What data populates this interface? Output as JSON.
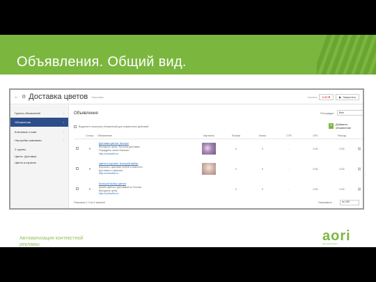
{
  "slide": {
    "title": "Объявления. Общий вид.",
    "footer_text": "Автоматизация контекстной рекламы",
    "logo_text": "aori",
    "logo_sub": "ads optimization",
    "colors": {
      "accent": "#7bb73f",
      "nav_active": "#2d4e8a",
      "link": "#2d6eb5",
      "balance": "#cc0000"
    }
  },
  "app": {
    "title": "Доставка цветов",
    "subtitle": "Черновик",
    "balance_label": "Баланс",
    "balance_value": "0.00 ₽",
    "launch_label": "Запустить",
    "icons": [
      "back-arrow-icon",
      "gear-icon",
      "play-icon"
    ]
  },
  "sidebar": {
    "items": [
      {
        "label": "Группы объявлений",
        "active": false
      },
      {
        "label": "Объявления",
        "active": true
      },
      {
        "label": "Ключевые слова",
        "active": false
      },
      {
        "label": "Настройки кампании",
        "active": false
      }
    ],
    "group_header": "2 группы",
    "groups": [
      "Цветы. Доставка",
      "Цветы в корзине"
    ]
  },
  "main": {
    "title": "Объявления",
    "period_label": "Площадки",
    "period_value": "Все",
    "toolbar_text": "Выделите несколько объявлений для совместных действий",
    "add_label": "Добавить объявление",
    "columns": [
      "Статус",
      "Объявление",
      "Картинка",
      "Показы",
      "Клики",
      "CTR",
      "CPC",
      "Расход"
    ],
    "rows": [
      {
        "title": "Доставка цветов. Быстро!",
        "line1": "Выгодные цены, быстрая доставка.",
        "line2": "Порадуйте своих близких!",
        "url": "http://cvetochki.ru",
        "shows": "0",
        "clicks": "0",
        "ctr": "-",
        "cpc": "0.00",
        "spend": "0.00",
        "thumb": "#b59bb8"
      },
      {
        "title": "Цветы в корзине. Большой выбор",
        "line1": "Корзины с цветами любой сложности.",
        "line2": "Доставка и гарантия.",
        "url": "http://cvetochki.ru",
        "shows": "0",
        "clicks": "0",
        "ctr": "-",
        "cpc": "0.00",
        "spend": "0.00",
        "thumb": "#c9b0a8"
      },
      {
        "title": "Большой выбор цветов",
        "line1": "Купить цветы с доставкой по России.",
        "line2": "Выгодные цены.",
        "url": "http://cvetochki.ru",
        "shows": "0",
        "clicks": "0",
        "ctr": "-",
        "cpc": "0.00",
        "spend": "0.00",
        "thumb": "#ffffff"
      }
    ],
    "pager_text": "Показаны 1-3 из 3 записей",
    "per_page_label": "Показывать",
    "per_page_value": "по 100"
  }
}
